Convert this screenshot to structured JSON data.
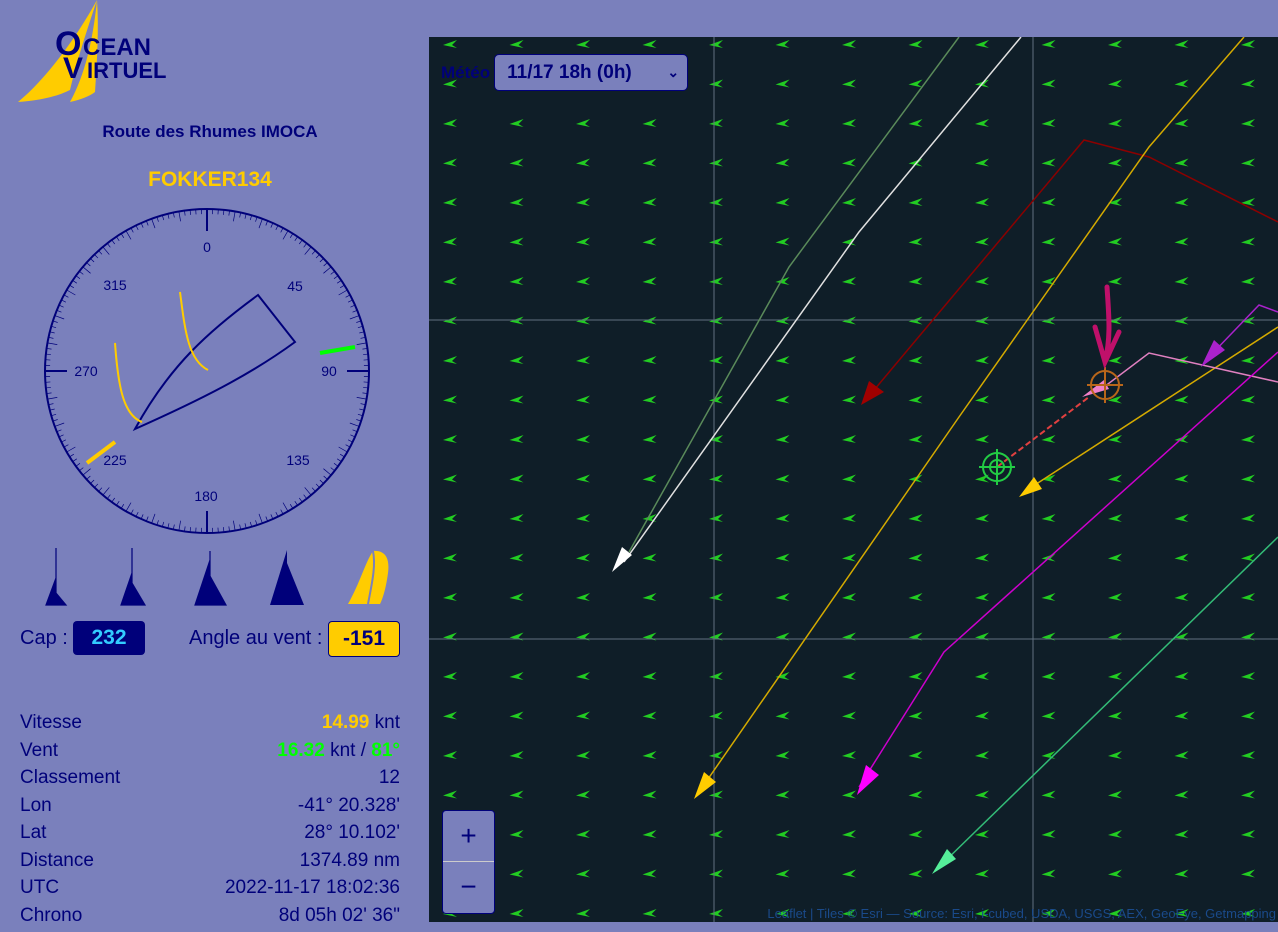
{
  "logo": {
    "line1": "OCEAN",
    "line2": "VIRTUEL"
  },
  "race_title": "Route des Rhumes IMOCA",
  "boat_name": "FOKKER134",
  "compass": {
    "labels": [
      "0",
      "45",
      "90",
      "135",
      "180",
      "225",
      "270",
      "315"
    ],
    "heading": 232,
    "wind_direction": 81
  },
  "sails": [
    {
      "name": "jib",
      "active": false
    },
    {
      "name": "spi",
      "active": false
    },
    {
      "name": "staysail",
      "active": false
    },
    {
      "name": "light-jib",
      "active": false
    },
    {
      "name": "code0",
      "active": true
    }
  ],
  "cap": {
    "label": "Cap :",
    "value": "232"
  },
  "twa": {
    "label": "Angle au vent :",
    "value": "-151"
  },
  "stats": {
    "speed": {
      "label": "Vitesse",
      "value": "14.99",
      "unit": "knt"
    },
    "wind": {
      "label": "Vent",
      "speed": "16.32",
      "unit": "knt /",
      "dir": "81°"
    },
    "rank": {
      "label": "Classement",
      "value": "12"
    },
    "lon": {
      "label": "Lon",
      "value": "-41° 20.328'"
    },
    "lat": {
      "label": "Lat",
      "value": "28° 10.102'"
    },
    "distance": {
      "label": "Distance",
      "value": "1374.89 nm"
    },
    "utc": {
      "label": "UTC",
      "value": "2022-11-17 18:02:36"
    },
    "chrono": {
      "label": "Chrono",
      "value": "8d 05h 02' 36\""
    }
  },
  "map": {
    "meteo_label": "Météo",
    "meteo_selected": "11/17 18h (0h)",
    "zoom_in": "+",
    "zoom_out": "−",
    "attribution": "Leaflet | Tiles © Esri — Source: Esri, i-cubed, USDA, USGS, AEX, GeoEye, Getmapping",
    "colors": {
      "wind_arrow": "#22cc22",
      "own_track": "#f080c8",
      "annotation": "#c0106a"
    }
  }
}
